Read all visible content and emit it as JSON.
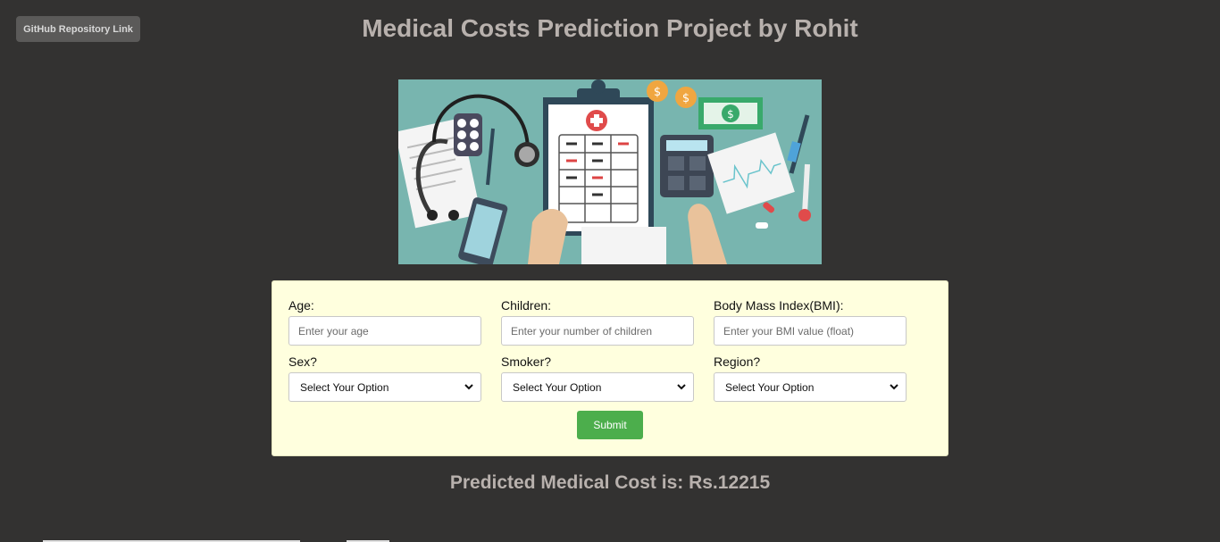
{
  "header": {
    "github_label": "GitHub Repository Link",
    "title": "Medical Costs Prediction Project by Rohit"
  },
  "form": {
    "age": {
      "label": "Age:",
      "placeholder": "Enter your age"
    },
    "children": {
      "label": "Children:",
      "placeholder": "Enter your number of children"
    },
    "bmi": {
      "label": "Body Mass Index(BMI):",
      "placeholder": "Enter your BMI value (float)"
    },
    "sex": {
      "label": "Sex?",
      "selected": "Select Your Option"
    },
    "smoker": {
      "label": "Smoker?",
      "selected": "Select Your Option"
    },
    "region": {
      "label": "Region?",
      "selected": "Select Your Option"
    },
    "submit_label": "Submit"
  },
  "result": {
    "text": "Predicted Medical Cost is: Rs.12215"
  },
  "colors": {
    "background": "#333231",
    "title_text": "#b8b1ad",
    "form_background": "#ffffde",
    "submit_button": "#4cae4c",
    "hero_background": "#78b5af"
  }
}
